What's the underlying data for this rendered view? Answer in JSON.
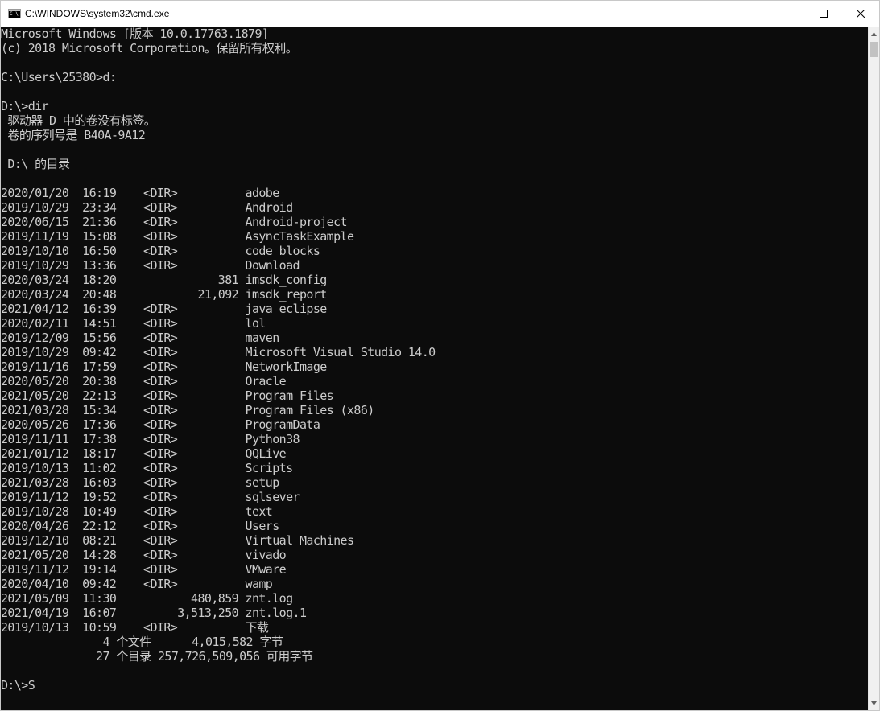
{
  "window": {
    "title": "C:\\WINDOWS\\system32\\cmd.exe",
    "controls": {
      "minimize": "minimize",
      "maximize": "maximize",
      "close": "close"
    }
  },
  "console": {
    "lines": [
      "Microsoft Windows [版本 10.0.17763.1879]",
      "(c) 2018 Microsoft Corporation。保留所有权利。",
      "",
      "C:\\Users\\25380>d:",
      "",
      "D:\\>dir",
      " 驱动器 D 中的卷没有标签。",
      " 卷的序列号是 B40A-9A12",
      "",
      " D:\\ 的目录",
      "",
      "2020/01/20  16:19    <DIR>          adobe",
      "2019/10/29  23:34    <DIR>          Android",
      "2020/06/15  21:36    <DIR>          Android-project",
      "2019/11/19  15:08    <DIR>          AsyncTaskExample",
      "2019/10/10  16:50    <DIR>          code blocks",
      "2019/10/29  13:36    <DIR>          Download",
      "2020/03/24  18:20               381 imsdk_config",
      "2020/03/24  20:48            21,092 imsdk_report",
      "2021/04/12  16:39    <DIR>          java eclipse",
      "2020/02/11  14:51    <DIR>          lol",
      "2019/12/09  15:56    <DIR>          maven",
      "2019/10/29  09:42    <DIR>          Microsoft Visual Studio 14.0",
      "2019/11/16  17:59    <DIR>          NetworkImage",
      "2020/05/20  20:38    <DIR>          Oracle",
      "2021/05/20  22:13    <DIR>          Program Files",
      "2021/03/28  15:34    <DIR>          Program Files (x86)",
      "2020/05/26  17:36    <DIR>          ProgramData",
      "2019/11/11  17:38    <DIR>          Python38",
      "2021/01/12  18:17    <DIR>          QQLive",
      "2019/10/13  11:02    <DIR>          Scripts",
      "2021/03/28  16:03    <DIR>          setup",
      "2019/11/12  19:52    <DIR>          sqlsever",
      "2019/10/28  10:49    <DIR>          text",
      "2020/04/26  22:12    <DIR>          Users",
      "2019/12/10  08:21    <DIR>          Virtual Machines",
      "2021/05/20  14:28    <DIR>          vivado",
      "2019/11/12  19:14    <DIR>          VMware",
      "2020/04/10  09:42    <DIR>          wamp",
      "2021/05/09  11:30           480,859 znt.log",
      "2021/04/19  16:07         3,513,250 znt.log.1",
      "2019/10/13  10:59    <DIR>          下载",
      "               4 个文件      4,015,582 字节",
      "              27 个目录 257,726,509,056 可用字节",
      ""
    ],
    "prompt": "D:\\>S"
  },
  "colors": {
    "console_background": "#0c0c0c",
    "console_text": "#cccccc",
    "titlebar_background": "#ffffff",
    "scrollbar_track": "#f0f0f0",
    "scrollbar_thumb": "#c2c2c2"
  },
  "icons": {
    "app": "cmd-app-icon",
    "minimize": "minimize-icon",
    "maximize": "maximize-icon",
    "close": "close-icon",
    "scroll_up": "scroll-up-arrow-icon",
    "scroll_down": "scroll-down-arrow-icon"
  }
}
